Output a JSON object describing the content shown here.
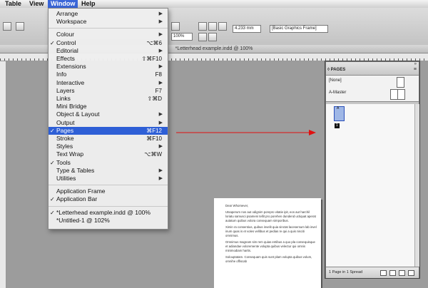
{
  "menubar": {
    "items": [
      {
        "label": "Table"
      },
      {
        "label": "View"
      },
      {
        "label": "Window"
      },
      {
        "label": "Help"
      }
    ]
  },
  "control": {
    "dimension_value": "4.233 mm",
    "zoom_value": "100%",
    "style_dropdown": "[Basic Graphics Frame]"
  },
  "document": {
    "title": "*Letterhead example.indd @ 100%",
    "greeting": "Dear Whomever,",
    "paragraphs": [
      "Utsaperum nos aut odignim porepro vitatie ipit, eos aut harchil loriatu samusci psameni tellit pro porehen dundend uctiquat aperat autatum quibus volora consequam simporibus.",
      "Ximin ra consentius, quibus invelit quia sinctat lacesersum lab invel inum quas is et voles vellibus et pedias re qui a quis nisciti omnimus.",
      "Omnimus magnam sim rem quias entibus a quo pla consequisque et adiandae voloremente volupta quibus velectur qui omnis minimodiam harits.",
      "Solouptatam. Consequam quis sunt plam volupta quibus volum, omnihe offiscab"
    ]
  },
  "window_menu": {
    "items": [
      {
        "label": "Arrange",
        "checked": false,
        "shortcut": "",
        "submenu": true
      },
      {
        "label": "Workspace",
        "checked": false,
        "shortcut": "",
        "submenu": true
      },
      {
        "label": "Colour",
        "checked": false,
        "shortcut": "",
        "submenu": true
      },
      {
        "label": "Control",
        "checked": true,
        "shortcut": "⌥⌘6",
        "submenu": false
      },
      {
        "label": "Editorial",
        "checked": false,
        "shortcut": "",
        "submenu": true
      },
      {
        "label": "Effects",
        "checked": false,
        "shortcut": "⇧⌘F10",
        "submenu": false
      },
      {
        "label": "Extensions",
        "checked": false,
        "shortcut": "",
        "submenu": true
      },
      {
        "label": "Info",
        "checked": false,
        "shortcut": "F8",
        "submenu": false
      },
      {
        "label": "Interactive",
        "checked": false,
        "shortcut": "",
        "submenu": true
      },
      {
        "label": "Layers",
        "checked": false,
        "shortcut": "F7",
        "submenu": false
      },
      {
        "label": "Links",
        "checked": false,
        "shortcut": "⇧⌘D",
        "submenu": false
      },
      {
        "label": "Mini Bridge",
        "checked": false,
        "shortcut": "",
        "submenu": false
      },
      {
        "label": "Object & Layout",
        "checked": false,
        "shortcut": "",
        "submenu": true
      },
      {
        "label": "Output",
        "checked": false,
        "shortcut": "",
        "submenu": true
      },
      {
        "label": "Pages",
        "checked": true,
        "shortcut": "⌘F12",
        "submenu": false,
        "highlighted": true
      },
      {
        "label": "Stroke",
        "checked": false,
        "shortcut": "⌘F10",
        "submenu": false
      },
      {
        "label": "Styles",
        "checked": false,
        "shortcut": "",
        "submenu": true
      },
      {
        "label": "Text Wrap",
        "checked": false,
        "shortcut": "⌥⌘W",
        "submenu": false
      },
      {
        "label": "Tools",
        "checked": true,
        "shortcut": "",
        "submenu": false
      },
      {
        "label": "Type & Tables",
        "checked": false,
        "shortcut": "",
        "submenu": true
      },
      {
        "label": "Utilities",
        "checked": false,
        "shortcut": "",
        "submenu": true
      },
      {
        "label": "Application Frame",
        "checked": false,
        "shortcut": "",
        "submenu": false
      },
      {
        "label": "Application Bar",
        "checked": true,
        "shortcut": "",
        "submenu": false
      },
      {
        "label": "*Letterhead example.indd @ 100%",
        "checked": true,
        "shortcut": "",
        "submenu": false
      },
      {
        "label": "*Untitled-1 @ 102%",
        "checked": false,
        "shortcut": "",
        "submenu": false
      }
    ],
    "check_mark": "✓",
    "submenu_arrow": "▶"
  },
  "pages_panel": {
    "tab_label": "◊ PAGES",
    "none_label": "[None]",
    "master_label": "A-Master",
    "page_prefix": "A",
    "page_number": "1",
    "status": "1 Page in 1 Spread",
    "menu_icon": "≡",
    "collapse_icon": "»"
  },
  "colors": {
    "menu_highlight": "#2e5fd6",
    "arrow": "#e01010",
    "page_selected": "#9fb7e6"
  }
}
